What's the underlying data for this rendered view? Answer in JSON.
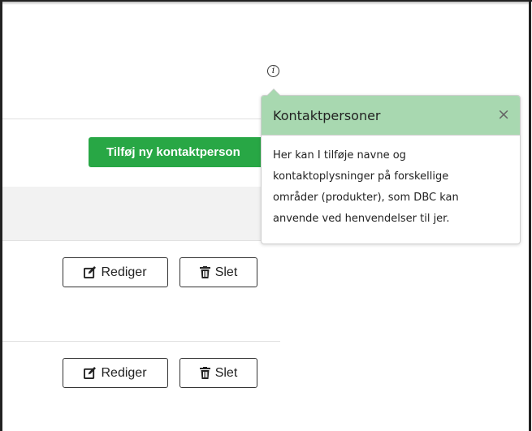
{
  "actions": {
    "add_contact_label": "Tilføj ny kontaktperson"
  },
  "info_icon": {
    "icon": "info-icon",
    "glyph": "i"
  },
  "rows": [
    {
      "edit_label": "Rediger",
      "delete_label": "Slet"
    },
    {
      "edit_label": "Rediger",
      "delete_label": "Slet"
    }
  ],
  "popover": {
    "title": "Kontaktpersoner",
    "close_glyph": "×",
    "body_lines": [
      "Her kan I tilføje navne og",
      "kontaktoplysninger på forskellige",
      "områder (produkter), som DBC kan",
      "anvende ved henvendelser til jer."
    ],
    "header_color": "#a8d8b0"
  },
  "colors": {
    "accent_green": "#28a745"
  }
}
